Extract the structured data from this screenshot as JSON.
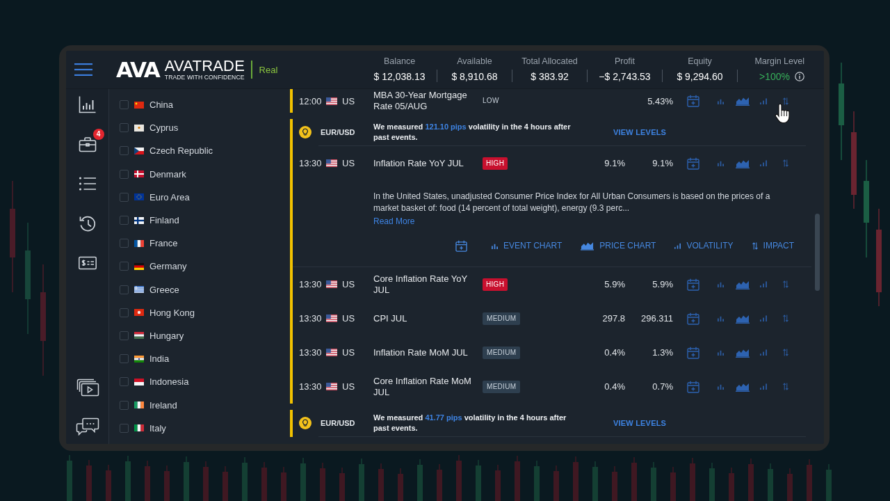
{
  "header": {
    "logo_mark": "AVA",
    "brand": "AVATRADE",
    "tagline": "TRADE WITH CONFIDENCE",
    "account": "Real",
    "stats": [
      {
        "label": "Balance",
        "value": "$ 12,038.13",
        "positive": false,
        "info": false
      },
      {
        "label": "Available",
        "value": "$ 8,910.68",
        "positive": false,
        "info": false
      },
      {
        "label": "Total Allocated",
        "value": "$ 383.92",
        "positive": false,
        "info": false
      },
      {
        "label": "Profit",
        "value": "−$ 2,743.53",
        "positive": false,
        "info": false
      },
      {
        "label": "Equity",
        "value": "$ 9,294.60",
        "positive": false,
        "info": false
      },
      {
        "label": "Margin Level",
        "value": ">100%",
        "positive": true,
        "info": true
      }
    ]
  },
  "nav_rail": {
    "top": [
      {
        "kind": "chart"
      },
      {
        "kind": "portfolio",
        "badge": "4"
      },
      {
        "kind": "list"
      },
      {
        "kind": "history"
      },
      {
        "kind": "payments"
      }
    ],
    "bottom": [
      {
        "kind": "video"
      },
      {
        "kind": "chat"
      }
    ]
  },
  "countries": [
    {
      "name": "China",
      "kind": "cn",
      "checked": false
    },
    {
      "name": "Cyprus",
      "kind": "cy",
      "checked": false
    },
    {
      "name": "Czech Republic",
      "kind": "cz",
      "checked": false
    },
    {
      "name": "Denmark",
      "kind": "dk",
      "checked": false
    },
    {
      "name": "Euro Area",
      "kind": "eu",
      "checked": false
    },
    {
      "name": "Finland",
      "kind": "fi",
      "checked": false
    },
    {
      "name": "France",
      "kind": "fr",
      "checked": false
    },
    {
      "name": "Germany",
      "kind": "de",
      "checked": false
    },
    {
      "name": "Greece",
      "kind": "gr",
      "checked": false
    },
    {
      "name": "Hong Kong",
      "kind": "hk",
      "checked": false
    },
    {
      "name": "Hungary",
      "kind": "hu",
      "checked": false
    },
    {
      "name": "India",
      "kind": "in",
      "checked": false
    },
    {
      "name": "Indonesia",
      "kind": "id",
      "checked": false
    },
    {
      "name": "Ireland",
      "kind": "ie",
      "checked": false
    },
    {
      "name": "Italy",
      "kind": "it",
      "checked": false
    }
  ],
  "event_groups": [
    {
      "events": [
        {
          "time": "12:00",
          "kind": "us",
          "country": "US",
          "title": "MBA 30-Year Mortgage Rate 05/AUG",
          "impact": {
            "label": "LOW",
            "kind": "low"
          },
          "column_2": "5.43%"
        }
      ]
    },
    {
      "insight": {
        "pair": "EUR/USD",
        "text": "We measured **121.10 pips** volatility in the 4 hours after past events.",
        "link": "VIEW LEVELS"
      },
      "events": [
        {
          "time": "13:30",
          "kind": "us",
          "country": "US",
          "title": "Inflation Rate YoY JUL",
          "impact": {
            "label": "HIGH",
            "kind": "high"
          },
          "column_1": "9.1%",
          "column_2": "9.1%",
          "details": {
            "description": "In the United States, unadjusted Consumer Price Index for All Urban Consumers is based on the prices of a market basket of: food (14 percent of total weight), energy (9.3 perc...",
            "link": "Read More",
            "actions": [
              {
                "kind": "calendar"
              },
              {
                "kind": "event_chart",
                "label": "EVENT CHART"
              },
              {
                "kind": "price_chart",
                "label": "PRICE CHART"
              },
              {
                "kind": "volatility",
                "label": "VOLATILITY"
              },
              {
                "kind": "impact",
                "label": "IMPACT"
              }
            ]
          }
        },
        {
          "time": "13:30",
          "kind": "us",
          "country": "US",
          "title": "Core Inflation Rate YoY JUL",
          "impact": {
            "label": "HIGH",
            "kind": "high"
          },
          "column_1": "5.9%",
          "column_2": "5.9%"
        },
        {
          "time": "13:30",
          "kind": "us",
          "country": "US",
          "title": "CPI JUL",
          "impact": {
            "label": "MEDIUM",
            "kind": "medium"
          },
          "column_1": "297.8",
          "column_2": "296.311"
        },
        {
          "time": "13:30",
          "kind": "us",
          "country": "US",
          "title": "Inflation Rate MoM JUL",
          "impact": {
            "label": "MEDIUM",
            "kind": "medium"
          },
          "column_1": "0.4%",
          "column_2": "1.3%"
        },
        {
          "time": "13:30",
          "kind": "us",
          "country": "US",
          "title": "Core Inflation Rate MoM JUL",
          "impact": {
            "label": "MEDIUM",
            "kind": "medium"
          },
          "column_1": "0.4%",
          "column_2": "0.7%"
        }
      ]
    },
    {
      "insight": {
        "pair": "EUR/USD",
        "text": "We measured **41.77 pips** volatility in the 4 hours after past events.",
        "link": "VIEW LEVELS"
      }
    }
  ]
}
